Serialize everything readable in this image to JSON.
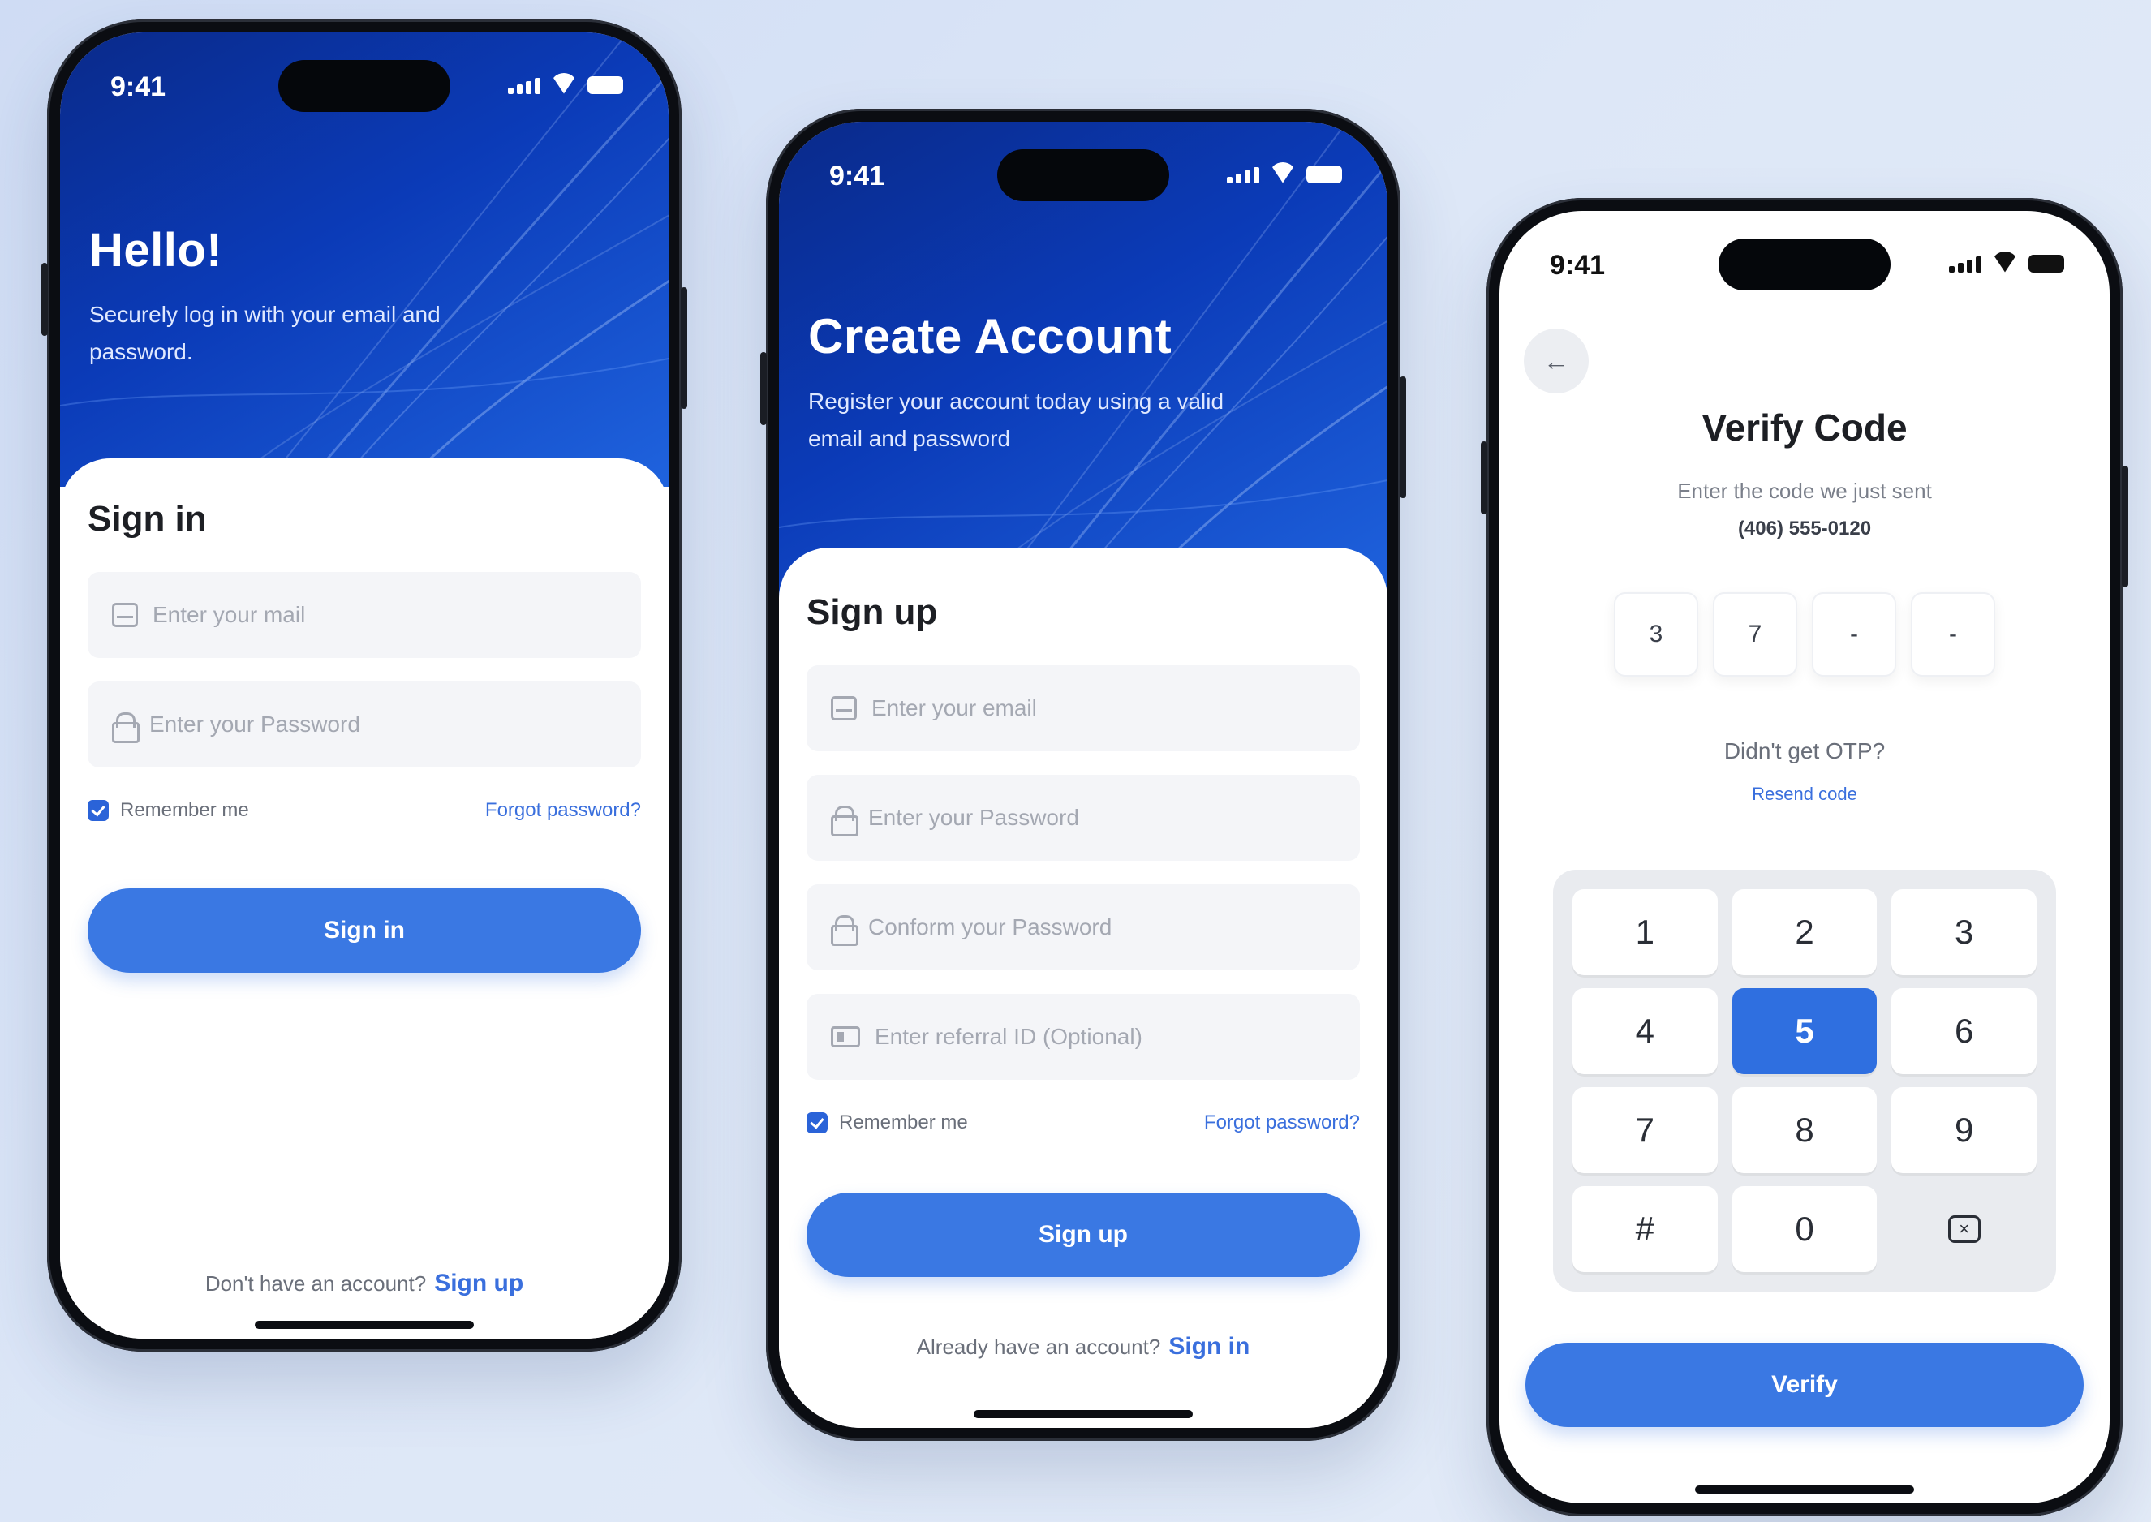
{
  "colors": {
    "accent": "#3a78e3",
    "hero_dark": "#0a2a8a",
    "hero_light": "#1f63de",
    "link": "#3a6fdd"
  },
  "status_bar": {
    "time": "9:41"
  },
  "sign_in_screen": {
    "hero_title": "Hello!",
    "hero_subtitle": "Securely log in with your email and password.",
    "card_title": "Sign in",
    "email_placeholder": "Enter your mail",
    "password_placeholder": "Enter your Password",
    "remember_label": "Remember me",
    "remember_checked": true,
    "forgot_label": "Forgot password?",
    "button_label": "Sign in",
    "footer_text": "Don't have an account?",
    "footer_link": "Sign up"
  },
  "sign_up_screen": {
    "hero_title": "Create Account",
    "hero_subtitle": "Register your account today using a valid email and password",
    "card_title": "Sign up",
    "email_placeholder": "Enter your email",
    "password_placeholder": "Enter your Password",
    "confirm_placeholder": "Conform your Password",
    "referral_placeholder": "Enter referral ID (Optional)",
    "remember_label": "Remember me",
    "remember_checked": true,
    "forgot_label": "Forgot password?",
    "button_label": "Sign up",
    "footer_text": "Already have an account?",
    "footer_link": "Sign in"
  },
  "verify_screen": {
    "back_icon": "arrow-left-icon",
    "title": "Verify Code",
    "subtitle": "Enter the code we just sent",
    "phone": "(406) 555-0120",
    "otp_digits": [
      "3",
      "7",
      "-",
      "-"
    ],
    "no_otp_text": "Didn't get OTP?",
    "resend_label": "Resend code",
    "keypad": [
      "1",
      "2",
      "3",
      "4",
      "5",
      "6",
      "7",
      "8",
      "9",
      "#",
      "0"
    ],
    "active_key": "5",
    "delete_icon": "backspace-icon",
    "button_label": "Verify"
  }
}
